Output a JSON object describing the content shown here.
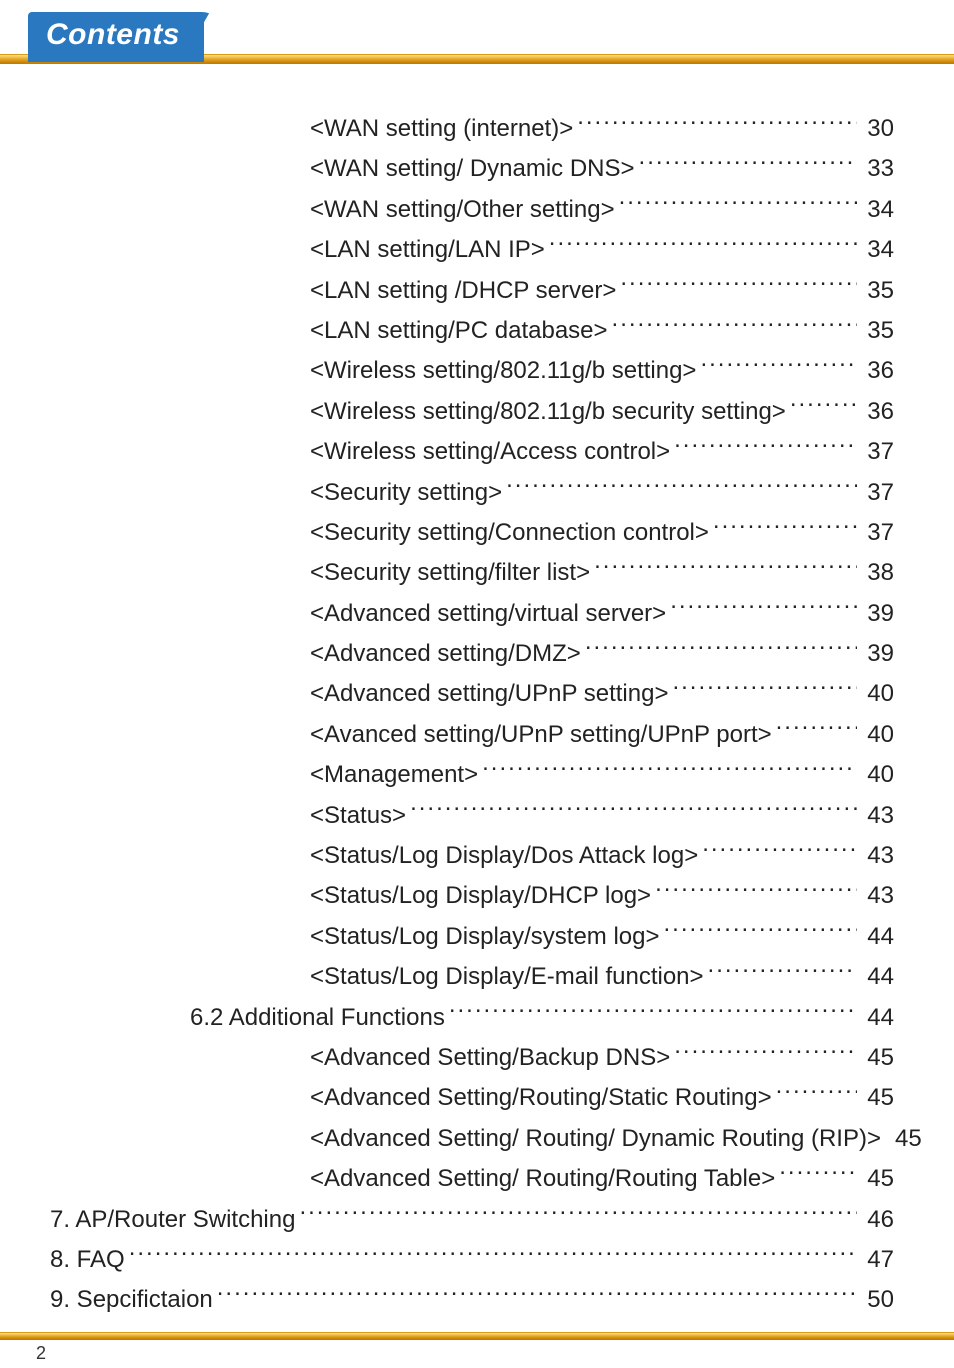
{
  "header": {
    "tab_label": "Contents"
  },
  "footer": {
    "page_number": "2"
  },
  "toc": {
    "rows": [
      {
        "indent": 3,
        "title": "<WAN setting (internet)>",
        "page": "30"
      },
      {
        "indent": 3,
        "title": "<WAN setting/ Dynamic DNS>",
        "page": "33"
      },
      {
        "indent": 3,
        "title": "<WAN setting/Other setting>",
        "page": "34"
      },
      {
        "indent": 3,
        "title": "<LAN setting/LAN IP>",
        "page": "34"
      },
      {
        "indent": 3,
        "title": "<LAN setting /DHCP server>",
        "page": "35"
      },
      {
        "indent": 3,
        "title": "<LAN setting/PC database>",
        "page": "35"
      },
      {
        "indent": 3,
        "title": "<Wireless setting/802.11g/b setting>",
        "page": "36"
      },
      {
        "indent": 3,
        "title": "<Wireless setting/802.11g/b security setting>",
        "page": "36"
      },
      {
        "indent": 3,
        "title": "<Wireless setting/Access control>",
        "page": "37"
      },
      {
        "indent": 3,
        "title": "<Security setting>",
        "page": "37"
      },
      {
        "indent": 3,
        "title": "<Security setting/Connection control>",
        "page": "37"
      },
      {
        "indent": 3,
        "title": "<Security setting/filter list>",
        "page": "38"
      },
      {
        "indent": 3,
        "title": "<Advanced setting/virtual server>",
        "page": "39"
      },
      {
        "indent": 3,
        "title": "<Advanced setting/DMZ>",
        "page": "39"
      },
      {
        "indent": 3,
        "title": "<Advanced setting/UPnP setting>",
        "page": "40"
      },
      {
        "indent": 3,
        "title": "<Avanced setting/UPnP setting/UPnP port>",
        "page": "40"
      },
      {
        "indent": 3,
        "title": "<Management>",
        "page": "40"
      },
      {
        "indent": 3,
        "title": "<Status>",
        "page": "43"
      },
      {
        "indent": 3,
        "title": "<Status/Log Display/Dos Attack log>",
        "page": "43"
      },
      {
        "indent": 3,
        "title": "<Status/Log Display/DHCP log>",
        "page": "43"
      },
      {
        "indent": 3,
        "title": "<Status/Log Display/system log>",
        "page": "44"
      },
      {
        "indent": 3,
        "title": "<Status/Log Display/E-mail function>",
        "page": "44"
      },
      {
        "indent": 2,
        "title": "6.2 Additional Functions",
        "page": "44"
      },
      {
        "indent": 3,
        "title": "<Advanced Setting/Backup DNS>",
        "page": "45"
      },
      {
        "indent": 3,
        "title": "<Advanced Setting/Routing/Static Routing>",
        "page": "45"
      },
      {
        "indent": 3,
        "title": "<Advanced Setting/ Routing/ Dynamic Routing (RIP)>",
        "page": "45"
      },
      {
        "indent": 3,
        "title": "<Advanced Setting/ Routing/Routing Table>",
        "page": "45"
      },
      {
        "indent": 1,
        "title": "7. AP/Router Switching",
        "page": "46"
      },
      {
        "indent": 1,
        "title": "8. FAQ",
        "page": "47"
      },
      {
        "indent": 1,
        "title": "9. Sepcifictaion",
        "page": "50"
      }
    ]
  }
}
